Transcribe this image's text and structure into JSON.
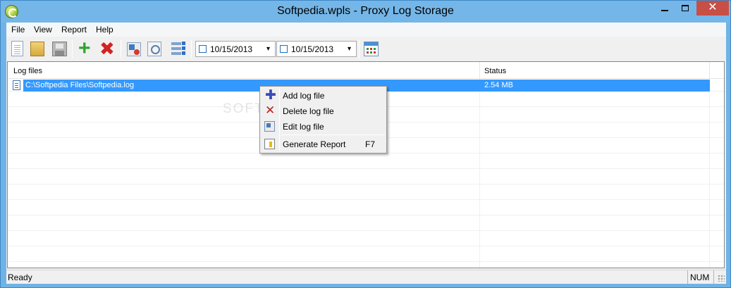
{
  "window": {
    "title": "Softpedia.wpls - Proxy Log Storage",
    "close_glyph": "✕"
  },
  "menu": {
    "file": "File",
    "view": "View",
    "report": "Report",
    "help": "Help"
  },
  "toolbar": {
    "icons": [
      "new-document-icon",
      "open-folder-icon",
      "save-icon",
      "add-icon",
      "delete-icon",
      "refresh-icon",
      "preview-icon",
      "checklist-icon",
      "calendar-icon"
    ],
    "date_from": "10/15/2013",
    "date_to": "10/15/2013",
    "dropdown_arrow": "▾"
  },
  "list": {
    "columns": [
      "Log files",
      "Status"
    ],
    "rows": [
      {
        "name": "C:\\Softpedia Files\\Softpedia.log",
        "status": "2.54 MB",
        "selected": true
      }
    ]
  },
  "context_menu": {
    "items": [
      {
        "label": "Add log file",
        "icon": "add-icon"
      },
      {
        "label": "Delete log file",
        "icon": "delete-icon"
      },
      {
        "label": "Edit log file",
        "icon": "edit-icon"
      },
      {
        "label": "Generate Report",
        "shortcut": "F7",
        "icon": "report-icon"
      }
    ]
  },
  "watermark": "SOFTPEDIA",
  "status": {
    "text": "Ready",
    "num": "NUM"
  },
  "colors": {
    "title_bar": "#75b6e8",
    "selection": "#3399ff",
    "close_button": "#c74f45"
  }
}
